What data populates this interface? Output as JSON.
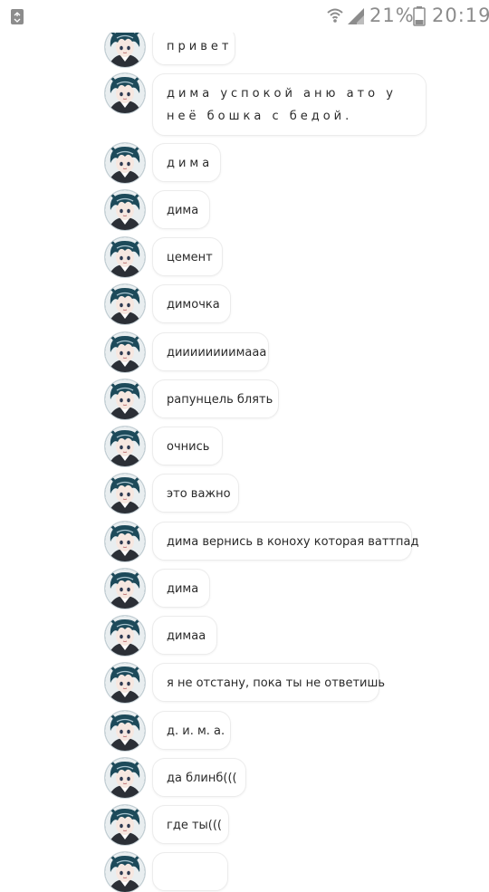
{
  "status_bar": {
    "battery_percent": "21%",
    "time": "20:19",
    "icons": [
      "recycle-icon",
      "wifi-icon",
      "signal-icon",
      "battery-icon"
    ]
  },
  "chat": {
    "messages": [
      {
        "text": "привет"
      },
      {
        "text": "дима успокой аню ато у неё бошка с бедой."
      },
      {
        "text": "дима"
      },
      {
        "text": "дима"
      },
      {
        "text": "цемент"
      },
      {
        "text": "димочка"
      },
      {
        "text": "диииииииимааа"
      },
      {
        "text": "рапунцель блять"
      },
      {
        "text": "очнись"
      },
      {
        "text": "это важно"
      },
      {
        "text": "дима вернись в коноху которая ваттпад"
      },
      {
        "text": "дима"
      },
      {
        "text": "димаа"
      },
      {
        "text": "я не отстану, пока ты не ответишь"
      },
      {
        "text": "д. и. м. а."
      },
      {
        "text": "да блинб((("
      },
      {
        "text": "где ты((("
      },
      {
        "text": ""
      }
    ]
  },
  "colors": {
    "status_icons": "#8c8c8c",
    "bubble_border": "#ececec",
    "avatar_hair": "#1d4a5a"
  }
}
